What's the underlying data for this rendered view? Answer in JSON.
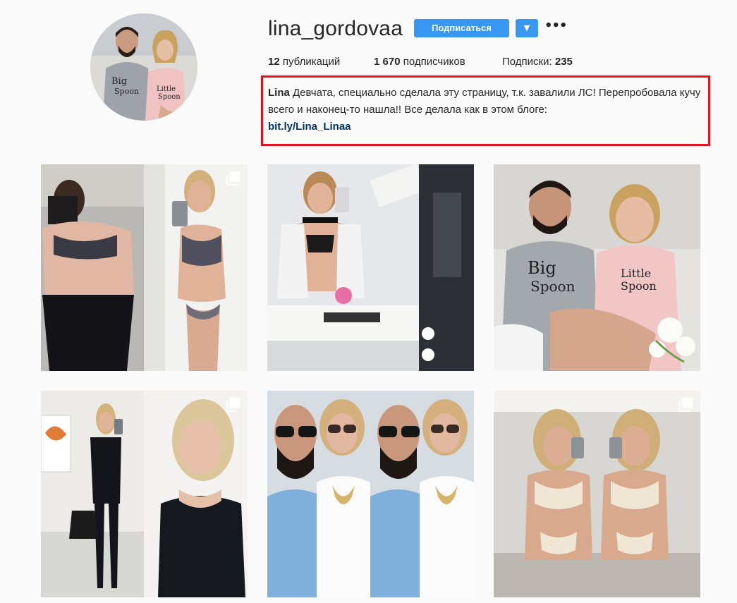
{
  "profile": {
    "username": "lina_gordovaa",
    "follow_label": "Подписаться",
    "dropdown_glyph": "▼",
    "more_glyph": "•••",
    "avatar_icon": "profile-avatar"
  },
  "stats": {
    "posts_count": "12",
    "posts_label": " публикаций",
    "followers_count": "1 670",
    "followers_label": " подписчиков",
    "following_label": "Подписки: ",
    "following_count": "235"
  },
  "bio": {
    "name": "Lina",
    "text": " Девчата, специально сделала эту страницу, т.к. завалили ЛС! Перепробовала кучу всего и наконец-то нашла!! Все делала как в этом блоге:",
    "link": "bit.ly/Lina_Linaa",
    "highlight_color": "#e0141e"
  },
  "colors": {
    "accent": "#3897f0",
    "link": "#003569",
    "background": "#fafafa"
  },
  "posts": [
    {
      "id": "post-1",
      "multi": true,
      "icon": "multiple-photos-icon"
    },
    {
      "id": "post-2",
      "multi": false
    },
    {
      "id": "post-3",
      "multi": false
    },
    {
      "id": "post-4",
      "multi": true,
      "icon": "multiple-photos-icon"
    },
    {
      "id": "post-5",
      "multi": false
    },
    {
      "id": "post-6",
      "multi": true,
      "icon": "multiple-photos-icon"
    }
  ]
}
